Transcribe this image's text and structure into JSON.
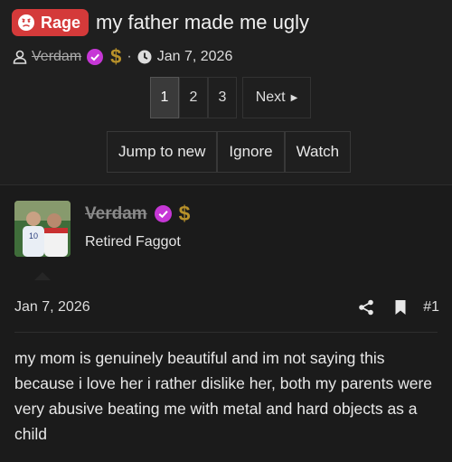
{
  "thread": {
    "badge": "Rage",
    "title": "my father made me ugly",
    "author": "Verdam",
    "dollar": "$",
    "separator": "·",
    "date": "Jan 7, 2026"
  },
  "pagination": {
    "pages": [
      "1",
      "2",
      "3"
    ],
    "current": "1",
    "next_label": "Next"
  },
  "actions": {
    "jump_label": "Jump to new",
    "ignore_label": "Ignore",
    "watch_label": "Watch"
  },
  "post": {
    "username": "Verdam",
    "user_title": "Retired Faggot",
    "dollar": "$",
    "date": "Jan 7, 2026",
    "number": "#1",
    "body": "my mom is genuinely beautiful and im not saying this because i love her i rather dislike her, both my parents were very abusive beating me with metal and hard objects as a child"
  },
  "colors": {
    "rage": "#d43a3a",
    "verified": "#c637d6",
    "dollar": "#b8912a"
  }
}
